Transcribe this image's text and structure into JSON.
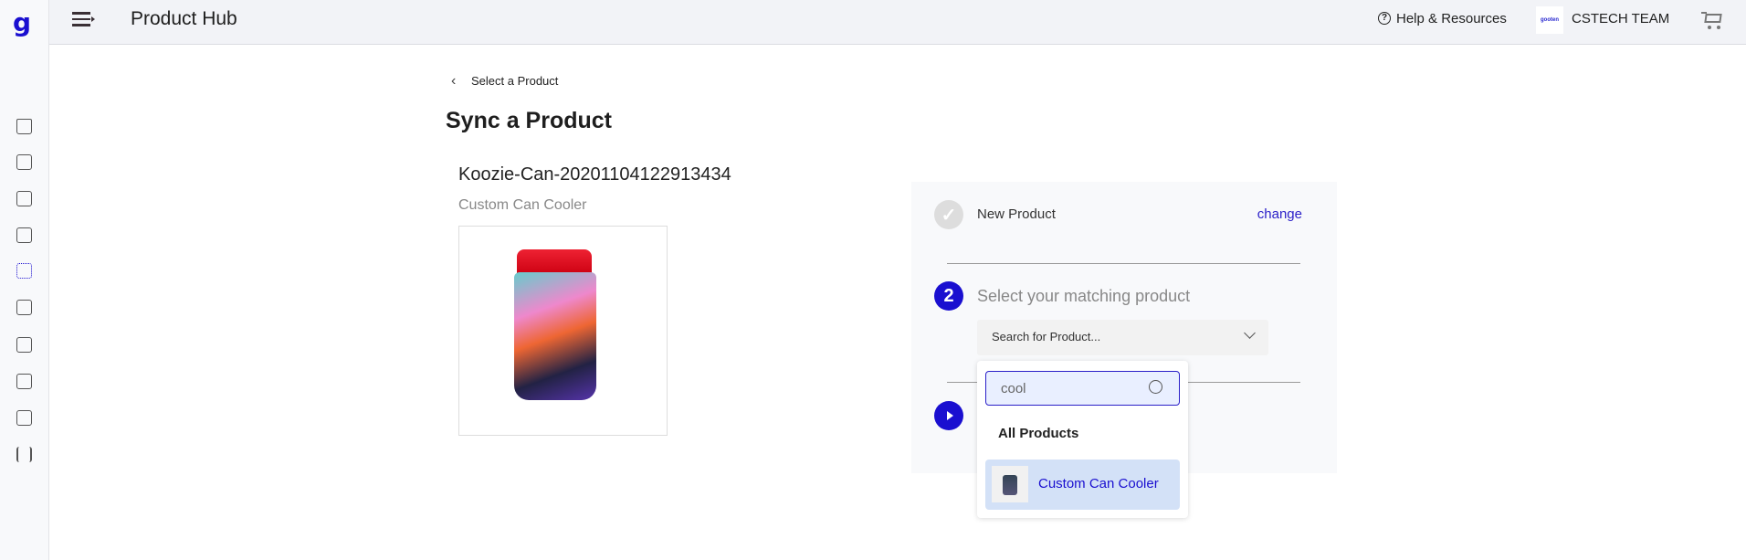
{
  "header": {
    "title": "Product Hub",
    "help_label": "Help & Resources",
    "team_name": "CSTECH TEAM",
    "team_logo_text": "gooten"
  },
  "sidebar": {
    "logo": "g",
    "items": [
      "home-icon",
      "catalog-icon",
      "upload-icon",
      "orders-icon",
      "product-hub-icon",
      "store-icon",
      "reports-icon",
      "calculator-icon",
      "archive-icon",
      "settings-sliders-icon"
    ],
    "active_index": 4
  },
  "breadcrumb": {
    "back_label": "Select a Product"
  },
  "page": {
    "title": "Sync a Product"
  },
  "product": {
    "name": "Koozie-Can-20201104122913434",
    "type": "Custom Can Cooler"
  },
  "steps": {
    "step1": {
      "label": "New Product",
      "change_label": "change"
    },
    "step2": {
      "number": "2",
      "label": "Select your matching product",
      "dropdown_placeholder": "Search for Product..."
    }
  },
  "dropdown": {
    "search_value": "cool",
    "group_label": "All Products",
    "options": [
      {
        "label": "Custom Can Cooler",
        "highlighted": true
      }
    ]
  },
  "colors": {
    "accent": "#1a0fd0",
    "highlight": "#d3e1f7"
  }
}
